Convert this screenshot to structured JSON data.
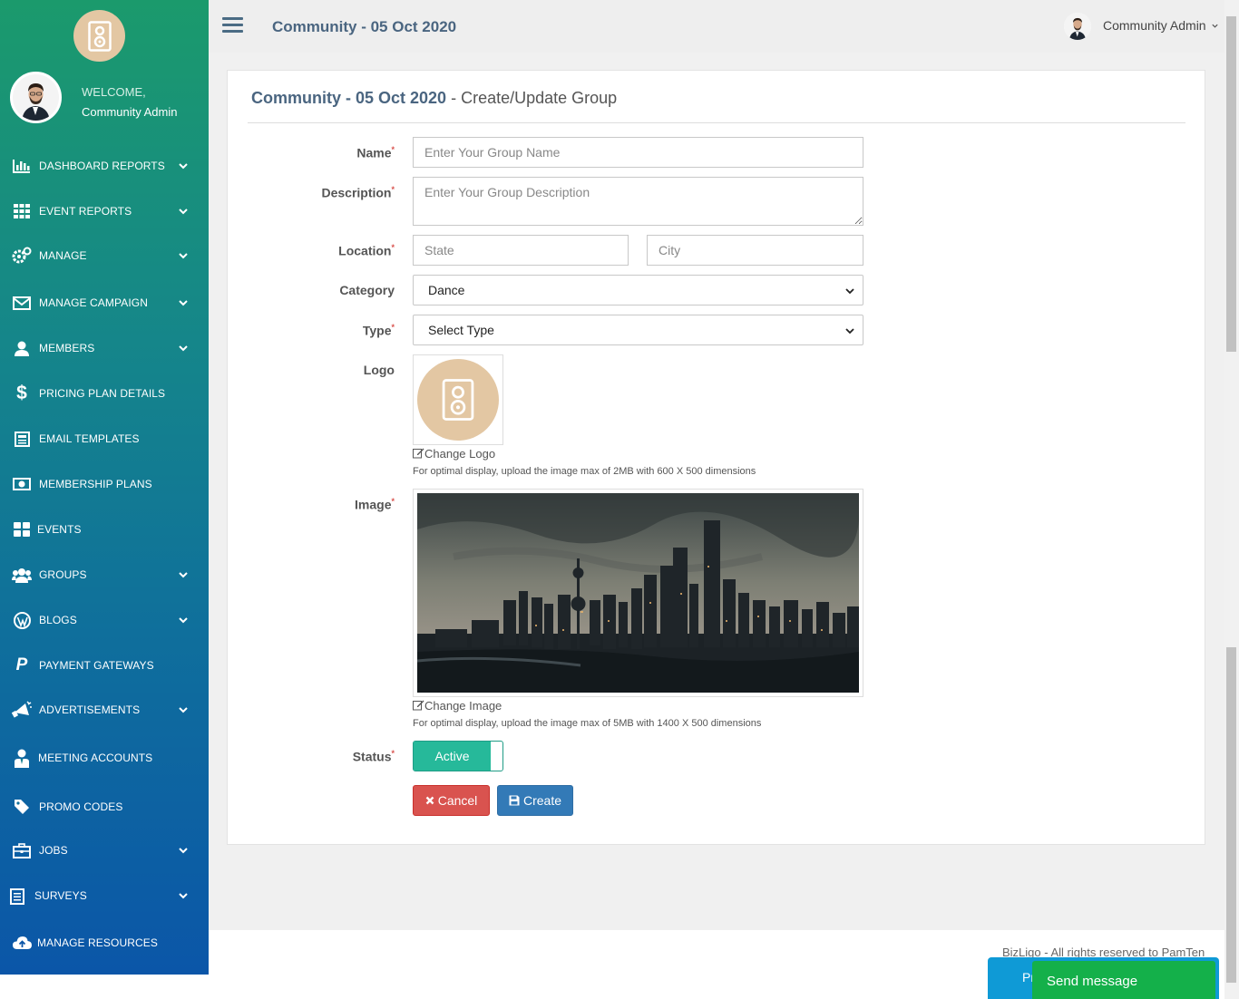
{
  "header": {
    "title": "Community - 05 Oct 2020",
    "user_name": "Community Admin"
  },
  "sidebar": {
    "welcome": "WELCOME,",
    "user": "Community Admin",
    "items": [
      {
        "label": "DASHBOARD REPORTS",
        "icon": "bar-chart-icon",
        "expandable": true
      },
      {
        "label": "EVENT REPORTS",
        "icon": "grid-icon",
        "expandable": true
      },
      {
        "label": "MANAGE",
        "icon": "gears-icon",
        "expandable": true
      },
      {
        "label": "MANAGE CAMPAIGN",
        "icon": "envelope-icon",
        "expandable": true
      },
      {
        "label": "MEMBERS",
        "icon": "user-icon",
        "expandable": true
      },
      {
        "label": "PRICING PLAN DETAILS",
        "icon": "dollar-icon",
        "expandable": false
      },
      {
        "label": "EMAIL TEMPLATES",
        "icon": "newspaper-icon",
        "expandable": false
      },
      {
        "label": "MEMBERSHIP PLANS",
        "icon": "money-icon",
        "expandable": false
      },
      {
        "label": "EVENTS",
        "icon": "th-large-icon",
        "expandable": false
      },
      {
        "label": "GROUPS",
        "icon": "users-icon",
        "expandable": true
      },
      {
        "label": "BLOGS",
        "icon": "wordpress-icon",
        "expandable": true
      },
      {
        "label": "PAYMENT GATEWAYS",
        "icon": "paypal-icon",
        "expandable": false
      },
      {
        "label": "ADVERTISEMENTS",
        "icon": "bullhorn-icon",
        "expandable": true
      },
      {
        "label": "MEETING ACCOUNTS",
        "icon": "user-tie-icon",
        "expandable": false
      },
      {
        "label": "PROMO CODES",
        "icon": "tag-icon",
        "expandable": false
      },
      {
        "label": "JOBS",
        "icon": "briefcase-icon",
        "expandable": true
      },
      {
        "label": "SURVEYS",
        "icon": "clipboard-icon",
        "expandable": true
      },
      {
        "label": "MANAGE RESOURCES",
        "icon": "cloud-upload-icon",
        "expandable": false
      }
    ]
  },
  "form": {
    "title_main": "Community - 05 Oct 2020",
    "title_sub": " - Create/Update Group",
    "name_label": "Name",
    "name_placeholder": "Enter Your Group Name",
    "description_label": "Description",
    "description_placeholder": "Enter Your Group Description",
    "location_label": "Location",
    "state_placeholder": "State",
    "city_placeholder": "City",
    "category_label": "Category",
    "category_value": "Dance",
    "type_label": "Type",
    "type_value": "Select Type",
    "logo_label": "Logo",
    "change_logo": "Change Logo",
    "logo_hint": "For optimal display, upload the image max of 2MB with 600 X 500 dimensions",
    "image_label": "Image",
    "change_image": "Change Image",
    "image_hint": "For optimal display, upload the image max of 5MB with 1400 X 500 dimensions",
    "status_label": "Status",
    "status_value": "Active",
    "cancel_label": "Cancel",
    "create_label": "Create",
    "required_mark": "*"
  },
  "footer": {
    "copyright": "BizLigo - All rights reserved to PamTen",
    "chat_partial": "Pr",
    "send_message": "Send message"
  },
  "colors": {
    "sidebar_top": "#1b9a6c",
    "sidebar_bottom": "#0b56a8",
    "active_green": "#26b99a",
    "cancel_red": "#d9534f",
    "create_blue": "#337ab7"
  }
}
